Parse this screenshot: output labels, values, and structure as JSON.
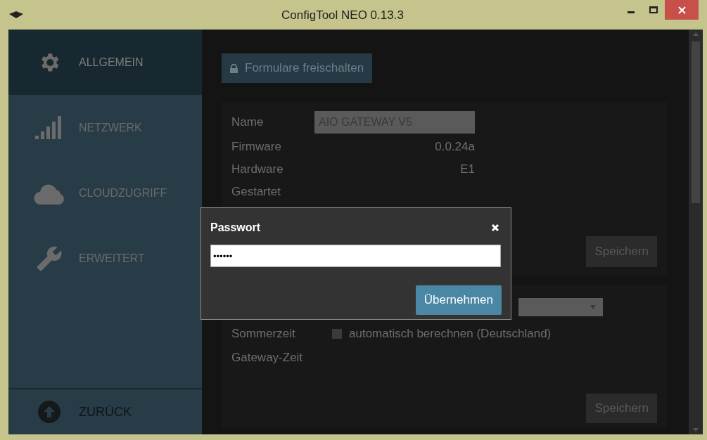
{
  "window": {
    "title": "ConfigTool NEO 0.13.3"
  },
  "sidebar": {
    "items": [
      {
        "label": "ALLGEMEIN",
        "selected": true
      },
      {
        "label": "NETZWERK",
        "selected": false
      },
      {
        "label": "CLOUDZUGRIFF",
        "selected": false
      },
      {
        "label": "ERWEITERT",
        "selected": false
      }
    ],
    "back_button": "ZURÜCK"
  },
  "unlock_button": "Formulare freischalten",
  "device_card": {
    "name_label": "Name",
    "name_value": "AIO GATEWAY V5",
    "rows": [
      {
        "label": "Firmware",
        "value": "0.0.24a"
      },
      {
        "label": "Hardware",
        "value": "E1"
      },
      {
        "label": "Gestartet",
        "value": ""
      }
    ],
    "save_button": "Speichern"
  },
  "time_card": {
    "summer_label": "Sommerzeit",
    "summer_checkbox": {
      "label": "automatisch berechnen (Deutschland)",
      "checked": false
    },
    "gateway_time_label": "Gateway-Zeit",
    "save_button": "Speichern"
  },
  "dialog": {
    "title": "Passwort",
    "password": "••••••",
    "submit_button": "Übernehmen"
  }
}
